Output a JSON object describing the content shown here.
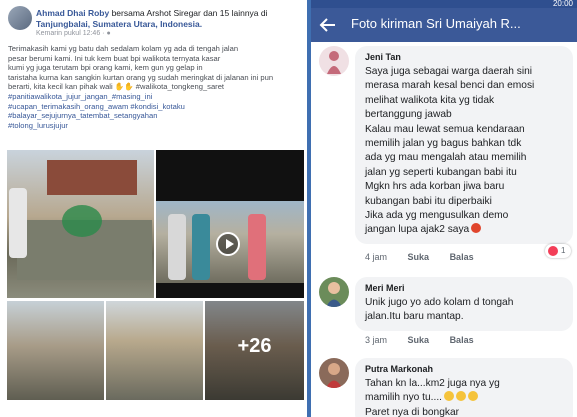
{
  "post": {
    "author": "Ahmad Dhai Roby",
    "with_text": "bersama Arshot Siregar dan 15 lainnya di",
    "location": "Tanjungbalai, Sumatera Utara, Indonesia.",
    "meta": "Kemarin pukul 12:46 · ",
    "lines": [
      "Terimakasih kami yg batu dah sedalam kolam yg ada di tengah jalan",
      "pesar berumi kami. Ini tuk kem buat bpi walikota ternyata kasar",
      "kumi yg juga terutam bpi orang kami, kem gun yg gelap in",
      "taristaha kurna kan sangkin kurtan orang yg sudah meringkat di jalanan ini pun",
      "berarti, kita kecil kan pihak wali ✋✋ #walikota_tongkeng_saret",
      "#panitiawalikota_jujur_jangan_#masing_ini"
    ],
    "hashtags": [
      "#ucapan_terimakasih_orang_awam #kondisi_kotaku",
      "#balayar_sejujurnya_tatembat_setangyahan",
      "#tolong_lurusjujur"
    ],
    "more_photos": "+26"
  },
  "app": {
    "status_time": "20:00",
    "title": "Foto kiriman Sri Umaiyah R..."
  },
  "comments": [
    {
      "name": "Jeni Tan",
      "lines": [
        "Saya juga sebagai warga daerah sini",
        "merasa marah kesal benci dan emosi",
        "melihat walikota kita yg tidak",
        "bertanggung jawab",
        "Kalau mau lewat semua kendaraan",
        "memilih jalan yg bagus bahkan tdk",
        "ada yg mau mengalah atau memilih",
        "jalan yg seperti kubangan babi itu",
        "Mgkn hrs ada korban jiwa baru",
        "kubangan babi itu diperbaiki",
        "Jika ada yg mengusulkan demo",
        "jangan lupa ajak2 saya"
      ],
      "time": "4 jam",
      "like": "Suka",
      "reply": "Balas",
      "reactions": "1"
    },
    {
      "name": "Meri Meri",
      "lines": [
        "Unik jugo yo ado kolam d tongah",
        "jalan.Itu baru mantap."
      ],
      "time": "3 jam",
      "like": "Suka",
      "reply": "Balas"
    },
    {
      "name": "Putra Markonah",
      "lines": [
        "Tahan kn la...km2 juga nya yg",
        "mamilih nyo tu....",
        "Paret nya di bongkar"
      ]
    }
  ],
  "colors": {
    "facebook_blue": "#3b5998",
    "link_blue": "#385898",
    "bubble_grey": "#f2f3f5",
    "love_red": "#f33e58"
  }
}
